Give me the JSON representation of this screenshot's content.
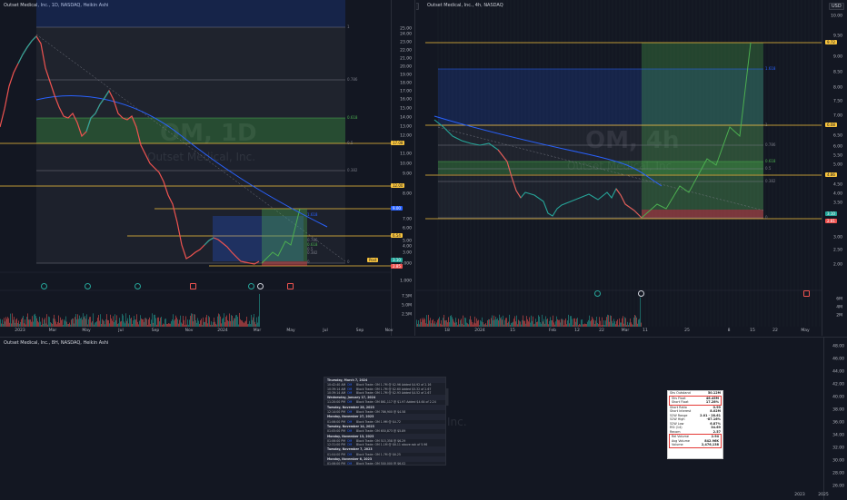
{
  "pane1": {
    "title": "Outset Medical, Inc., 1D, NASDAQ, Heikin Ashi",
    "watermark": "OM, 1D",
    "watermark_sub": "Outset Medical, Inc.",
    "price_axis": [
      "25.00",
      "24.00",
      "23.00",
      "22.00",
      "21.00",
      "20.00",
      "19.00",
      "18.00",
      "17.00",
      "16.00",
      "15.00",
      "14.00",
      "13.00",
      "12.00",
      "11.00",
      "10.00",
      "9.00",
      "8.00",
      "7.00",
      "6.00",
      "5.00",
      "4.00",
      "3.00",
      "2.000",
      "1.000"
    ],
    "time_axis": [
      "2023",
      "Mar",
      "May",
      "Jul",
      "Sep",
      "Nov",
      "2024",
      "Mar",
      "May",
      "Jul",
      "Sep",
      "Nov"
    ],
    "fib_levels": [
      {
        "label": "1",
        "color": "#787b86"
      },
      {
        "label": "0.786",
        "color": "#787b86"
      },
      {
        "label": "0.618",
        "color": "#4caf50"
      },
      {
        "label": "0.5",
        "color": "#787b86"
      },
      {
        "label": "0.382",
        "color": "#787b86"
      },
      {
        "label": "0",
        "color": "#787b86"
      }
    ],
    "small_fib": [
      {
        "label": "1.618",
        "color": "#2962ff"
      },
      {
        "label": "0.786",
        "color": "#787b86"
      },
      {
        "label": "0.618",
        "color": "#4caf50"
      },
      {
        "label": "0.5",
        "color": "#787b86"
      },
      {
        "label": "0.382",
        "color": "#787b86"
      },
      {
        "label": "0",
        "color": "#787b86"
      }
    ],
    "price_tags": [
      {
        "text": "17.08",
        "color": "#f7c33d"
      },
      {
        "text": "12.00",
        "color": "#f7c33d"
      },
      {
        "text": "9.00",
        "color": "#2962ff"
      },
      {
        "text": "6.54",
        "color": "#f7c33d"
      },
      {
        "text": "3.10",
        "color": "#26a69a"
      },
      {
        "text": "2.85",
        "color": "#ef5350"
      }
    ],
    "side_tag": "Post",
    "volume_axis": [
      "7.5M",
      "5.0M",
      "2.5M"
    ]
  },
  "pane2": {
    "title": "Outset Medical, Inc., 4h, NASDAQ",
    "currency": "USD",
    "watermark": "OM, 4h",
    "watermark_sub": "Outset Medical, Inc.",
    "price_axis": [
      "10.00",
      "9.50",
      "9.00",
      "8.50",
      "8.00",
      "7.50",
      "7.00",
      "6.50",
      "6.00",
      "5.50",
      "5.00",
      "4.50",
      "4.00",
      "3.50",
      "3.00",
      "2.50",
      "2.00"
    ],
    "time_axis": [
      "18",
      "2024",
      "15",
      "Feb",
      "12",
      "22",
      "Mar",
      "11",
      "25",
      "8",
      "15",
      "22",
      "May"
    ],
    "fib_levels": [
      {
        "label": "1.618",
        "color": "#2962ff"
      },
      {
        "label": "1",
        "color": "#787b86"
      },
      {
        "label": "0.786",
        "color": "#787b86"
      },
      {
        "label": "0.618",
        "color": "#4caf50"
      },
      {
        "label": "0.5",
        "color": "#787b86"
      },
      {
        "label": "0.382",
        "color": "#787b86"
      },
      {
        "label": "0",
        "color": "#787b86"
      }
    ],
    "price_tags": [
      {
        "text": "9.72",
        "color": "#f7c33d"
      },
      {
        "text": "6.08",
        "color": "#f7c33d"
      },
      {
        "text": "4.86",
        "color": "#f7c33d"
      },
      {
        "text": "3.10",
        "color": "#26a69a"
      },
      {
        "text": "2.81",
        "color": "#ef5350"
      }
    ],
    "volume_axis": [
      "6M",
      "4M",
      "2M"
    ]
  },
  "pane3": {
    "title": "Outset Medical, Inc., 8H, NASDAQ, Heikin Ashi",
    "price_axis": [
      "48.00",
      "46.00",
      "44.00",
      "42.00",
      "40.00",
      "38.00",
      "36.00",
      "34.00",
      "32.00",
      "30.00",
      "28.00",
      "26.00"
    ],
    "time_axis": [
      "2023",
      "2025"
    ]
  },
  "time_sales": [
    {
      "date": "Thursday, March 7, 2024",
      "rows": [
        {
          "time": "10:42:40 AM",
          "sym": "OM",
          "text": "Block Trade: OM 1.7M @ $2.96 Added $4.92 of 2.16"
        },
        {
          "time": "10:39:14 AM",
          "sym": "OM",
          "text": "Block Trade: OM 1.7M @ $2.60 Added $5.32 of 2.67"
        },
        {
          "time": "10:39:14 AM",
          "sym": "OM",
          "text": "Block Trade: OM 1.7M @ $2.93 Added $4.52 of 2.67"
        }
      ]
    },
    {
      "date": "Wednesday, January 17, 2024",
      "rows": [
        {
          "time": "11:20:00 PM",
          "sym": "OM",
          "text": "Block Trade: OM 861,117 @ $1.97 Added $4.64 of 2.24"
        }
      ]
    },
    {
      "date": "Tuesday, November 28, 2023",
      "rows": [
        {
          "time": "12:14:00 PM",
          "sym": "OM",
          "text": "Block Trade: OM 786,900 @ $4.58"
        }
      ]
    },
    {
      "date": "Monday, November 27, 2023",
      "rows": [
        {
          "time": "01:06:00 PM",
          "sym": "OM",
          "text": "Block Trade: OM 1.9M @ $4.72"
        }
      ]
    },
    {
      "date": "Tuesday, November 14, 2023",
      "rows": [
        {
          "time": "01:05:00 PM",
          "sym": "OM",
          "text": "Block Trade: OM 650,873 @ $5.89"
        }
      ]
    },
    {
      "date": "Monday, November 13, 2023",
      "rows": [
        {
          "time": "01:06:00 PM",
          "sym": "OM",
          "text": "Block Trade: OM 515,358 @ $6.29"
        },
        {
          "time": "12:31:00 PM",
          "sym": "OM",
          "text": "Block Trade: OM 1.1M @ $6.11 above ask of 5.96"
        }
      ]
    },
    {
      "date": "Tuesday, November 7, 2023",
      "rows": [
        {
          "time": "01:04:00 PM",
          "sym": "OM",
          "text": "Block Trade: OM 1.7M @ $6.25"
        }
      ]
    },
    {
      "date": "Monday, November 6, 2023",
      "rows": [
        {
          "time": "01:06:00 PM",
          "sym": "OM",
          "text": "Block Trade: OM 500,000 @ $6.02"
        }
      ]
    }
  ],
  "stats": [
    {
      "k": "Shs Outstand",
      "v": "50.12M",
      "box": 0
    },
    {
      "k": "Shs Float",
      "v": "46.45M",
      "box": 1
    },
    {
      "k": "Short Float",
      "v": "17.28%",
      "box": 1
    },
    {
      "k": "Short Ratio",
      "v": "0.99",
      "box": 0
    },
    {
      "k": "Short Interest",
      "v": "8.02M",
      "box": 0
    },
    {
      "k": "52W Range",
      "v": "2.01 - 28.61",
      "box": 0
    },
    {
      "k": "52W High",
      "v": "-87.16%",
      "box": 0
    },
    {
      "k": "52W Low",
      "v": "6.87%",
      "box": 0
    },
    {
      "k": "RSI (14)",
      "v": "34.69",
      "box": 0
    },
    {
      "k": "Recom",
      "v": "2.57",
      "box": 0
    },
    {
      "k": "Rel Volume",
      "v": "2.94",
      "box": 2
    },
    {
      "k": "Avg Volume",
      "v": "842.96K",
      "box": 2
    },
    {
      "k": "Volume",
      "v": "2,476,138",
      "box": 2
    }
  ]
}
